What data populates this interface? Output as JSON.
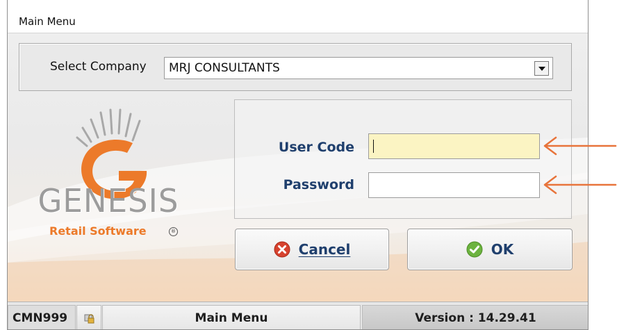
{
  "window": {
    "title": "Main Menu"
  },
  "company": {
    "label": "Select Company",
    "selected": "MRJ CONSULTANTS"
  },
  "logo": {
    "name": "GENESIS",
    "tagline": "Retail Software",
    "reg_mark": "®"
  },
  "login": {
    "user_code_label": "User Code",
    "user_code_value": "",
    "password_label": "Password",
    "password_value": ""
  },
  "buttons": {
    "cancel_label": "Cancel",
    "ok_label": "OK"
  },
  "statusbar": {
    "code": "CMN999",
    "title": "Main Menu",
    "version": "Version : 14.29.41"
  },
  "icons": {
    "dropdown": "chevron-down-icon",
    "cancel": "cancel-icon",
    "ok": "check-icon",
    "lock": "lock-icon",
    "annotation": "arrow-left-icon"
  },
  "colors": {
    "label_blue": "#1f3f6d",
    "brand_orange": "#ec7a2a",
    "active_input": "#fbf4c3",
    "annotation_arrow": "#e8743b"
  }
}
